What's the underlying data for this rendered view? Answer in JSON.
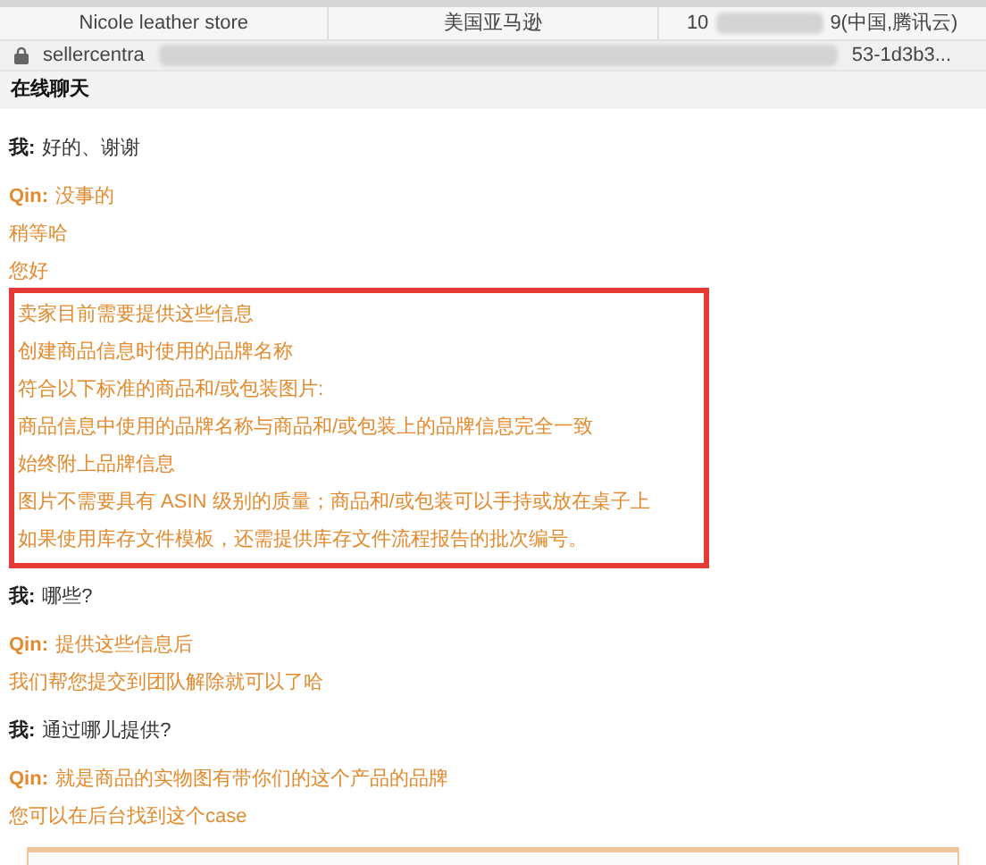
{
  "tabs": [
    {
      "segments": [
        "Nicole leather store"
      ]
    },
    {
      "segments": [
        "美国亚马逊"
      ]
    },
    {
      "segments": [
        "10",
        "9(中国,腾讯云)"
      ]
    }
  ],
  "address_bar": {
    "start": "sellercentra",
    "end": "53-1d3b3..."
  },
  "chat": {
    "title": "在线聊天",
    "messages": [
      {
        "kind": "me",
        "speaker": "我:",
        "lines": [
          "好的、谢谢"
        ]
      },
      {
        "kind": "agent",
        "speaker": "Qin:",
        "lines": [
          "没事的",
          "稍等哈",
          "您好"
        ],
        "boxed_lines": [
          "卖家目前需要提供这些信息",
          "创建商品信息时使用的品牌名称",
          "符合以下标准的商品和/或包装图片:",
          "商品信息中使用的品牌名称与商品和/或包装上的品牌信息完全一致",
          "始终附上品牌信息",
          "图片不需要具有 ASIN 级别的质量；商品和/或包装可以手持或放在桌子上",
          "如果使用库存文件模板，还需提供库存文件流程报告的批次编号。"
        ]
      },
      {
        "kind": "me",
        "speaker": "我:",
        "lines": [
          "哪些?"
        ]
      },
      {
        "kind": "agent",
        "speaker": "Qin:",
        "lines": [
          "提供这些信息后",
          "我们帮您提交到团队解除就可以了哈"
        ]
      },
      {
        "kind": "me",
        "speaker": "我:",
        "lines": [
          "通过哪儿提供?"
        ]
      },
      {
        "kind": "agent",
        "speaker": "Qin:",
        "lines": [
          "就是商品的实物图有带你们的这个产品的品牌",
          "您可以在后台找到这个case"
        ]
      }
    ]
  }
}
